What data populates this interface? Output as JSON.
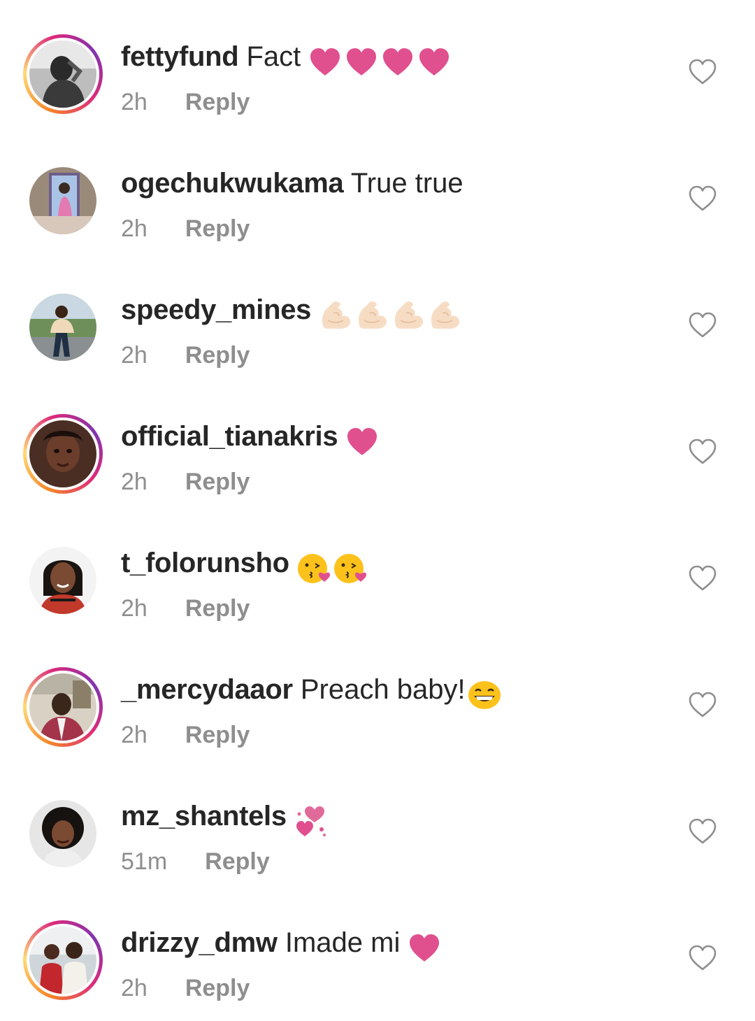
{
  "comments": [
    {
      "username": "fettyfund",
      "text": "Fact",
      "emoji": [
        "pink-heart",
        "pink-heart",
        "pink-heart",
        "pink-heart"
      ],
      "time": "2h",
      "reply": "Reply",
      "story_ring": true,
      "avatar": "grayscale-portrait"
    },
    {
      "username": "ogechukwukama",
      "text": "True true",
      "emoji": [],
      "time": "2h",
      "reply": "Reply",
      "story_ring": false,
      "avatar": "framed-photo"
    },
    {
      "username": "speedy_mines",
      "text": "",
      "emoji": [
        "flexed-biceps",
        "flexed-biceps",
        "flexed-biceps",
        "flexed-biceps"
      ],
      "time": "2h",
      "reply": "Reply",
      "story_ring": false,
      "avatar": "outdoor-portrait"
    },
    {
      "username": "official_tianakris",
      "text": "",
      "emoji": [
        "pink-heart"
      ],
      "time": "2h",
      "reply": "Reply",
      "story_ring": true,
      "avatar": "face-portrait"
    },
    {
      "username": "t_folorunsho",
      "text": "",
      "emoji": [
        "kissing-face",
        "kissing-face"
      ],
      "time": "2h",
      "reply": "Reply",
      "story_ring": false,
      "avatar": "smiling-portrait"
    },
    {
      "username": "_mercydaaor",
      "text": "Preach baby!",
      "emoji": [
        "grinning-face"
      ],
      "time": "2h",
      "reply": "Reply",
      "story_ring": true,
      "avatar": "indoor-portrait"
    },
    {
      "username": "mz_shantels",
      "text": "",
      "emoji": [
        "two-hearts"
      ],
      "time": "51m",
      "reply": "Reply",
      "story_ring": false,
      "avatar": "afro-portrait"
    },
    {
      "username": "drizzy_dmw",
      "text": "Imade mi",
      "emoji": [
        "pink-heart"
      ],
      "time": "2h",
      "reply": "Reply",
      "story_ring": true,
      "avatar": "two-people-photo"
    }
  ],
  "icons": {
    "like": "heart-outline-icon"
  },
  "colors": {
    "text": "#262626",
    "meta": "#8e8e8e",
    "heart_emoji": "#e0508f",
    "like_outline": "#8e8e8e"
  }
}
